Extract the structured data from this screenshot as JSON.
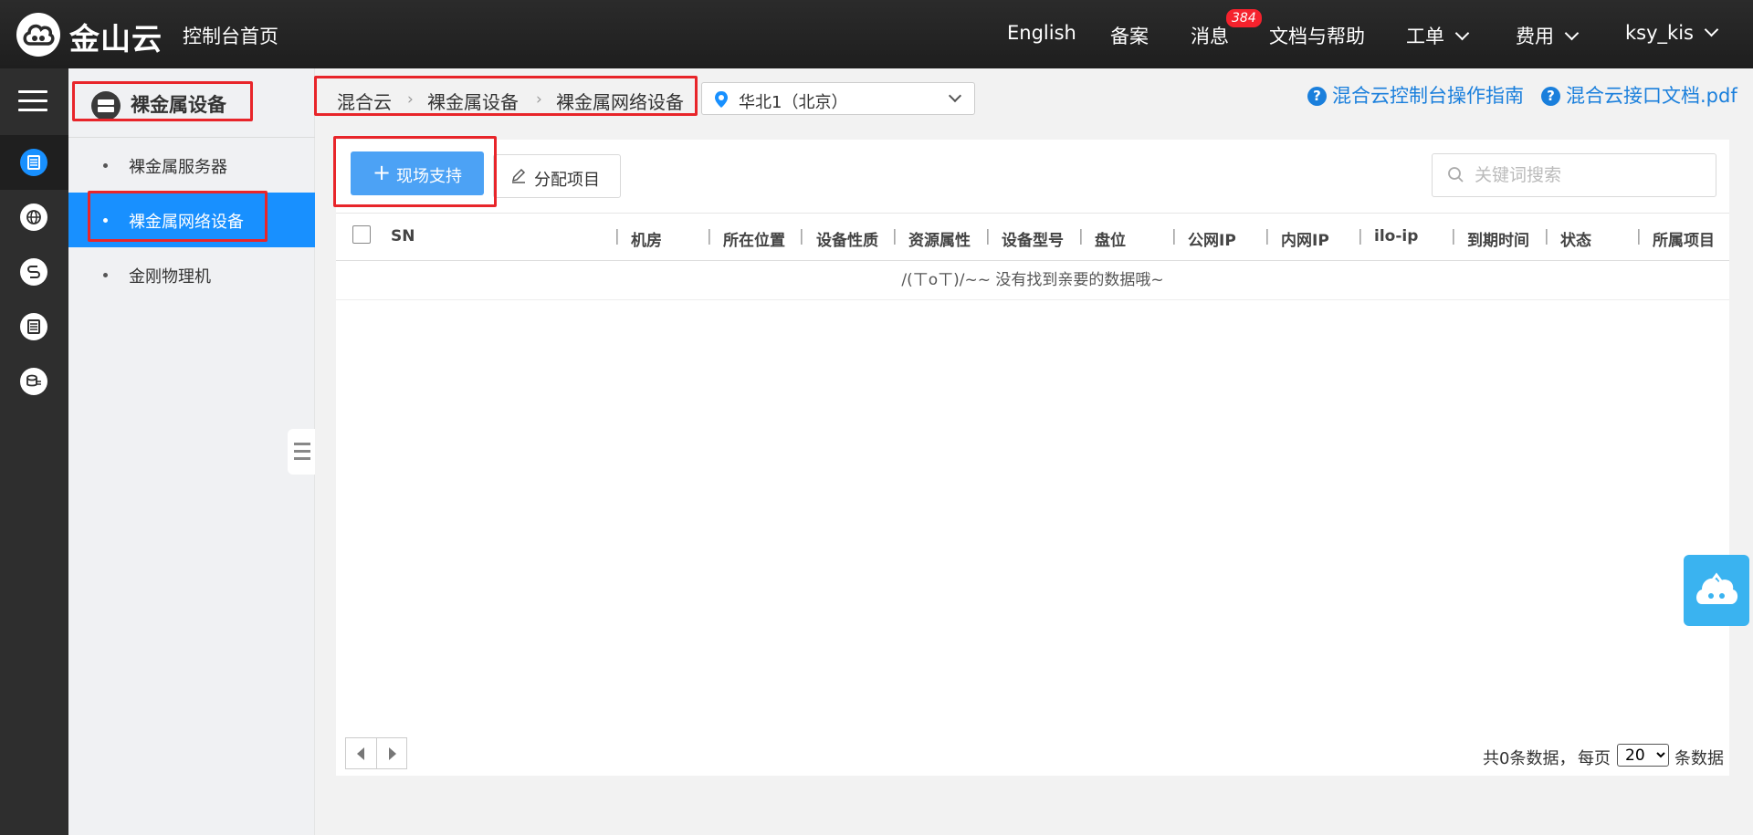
{
  "topbar": {
    "brand": "金山云",
    "console_home": "控制台首页",
    "nav": {
      "english": "English",
      "filing": "备案",
      "messages": "消息",
      "messages_badge": "384",
      "docs": "文档与帮助",
      "tickets": "工单",
      "billing": "费用",
      "user": "ksy_kis"
    }
  },
  "sidebar": {
    "title": "裸金属设备",
    "items": [
      {
        "label": "裸金属服务器"
      },
      {
        "label": "裸金属网络设备"
      },
      {
        "label": "金刚物理机"
      }
    ]
  },
  "breadcrumb": [
    "混合云",
    "裸金属设备",
    "裸金属网络设备"
  ],
  "region": {
    "selected": "华北1（北京）"
  },
  "help_links": {
    "guide": "混合云控制台操作指南",
    "api_doc": "混合云接口文档.pdf"
  },
  "toolbar": {
    "onsite_support": "现场支持",
    "assign_project": "分配项目",
    "search_placeholder": "关键词搜索"
  },
  "table": {
    "columns": [
      "SN",
      "机房",
      "所在位置",
      "设备性质",
      "资源属性",
      "设备型号",
      "盘位",
      "公网IP",
      "内网IP",
      "ilo-ip",
      "到期时间",
      "状态",
      "所属项目"
    ],
    "empty_text": "/(ㄒoㄒ)/~~ 没有找到亲要的数据哦~"
  },
  "footer": {
    "total": "共0条数据，",
    "per_page_label": "每页",
    "page_size": "20",
    "unit": "条数据"
  },
  "colors": {
    "accent": "#1890ff",
    "highlight": "#e8252a",
    "link": "#1a7fdc"
  }
}
